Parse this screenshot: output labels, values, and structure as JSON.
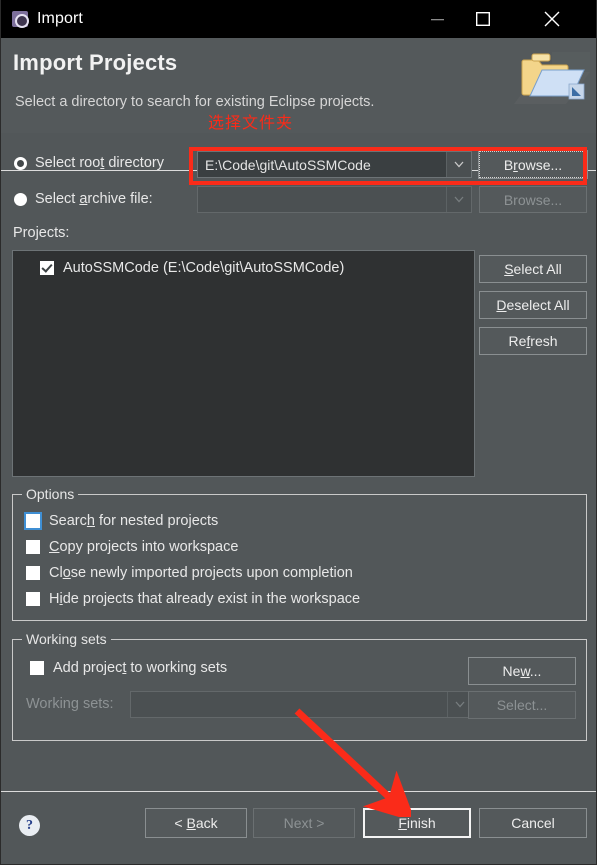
{
  "window": {
    "title": "Import",
    "icon": "eclipse-import-icon",
    "controls": {
      "minimize": "minimize-icon",
      "maximize": "maximize-icon",
      "close": "close-icon"
    }
  },
  "header": {
    "title": "Import Projects",
    "description": "Select a directory to search for existing Eclipse projects.",
    "annotation": "选择文件夹",
    "icon": "open-folder-icon",
    "annotation_color": "#fa2b19"
  },
  "source": {
    "root_directory": {
      "label": "Select roo",
      "label_accel": "t",
      "label_tail": " directory",
      "selected": true,
      "value": "E:\\Code\\git\\AutoSSMCode",
      "browse_label_head": "B",
      "browse_label_accel": "r",
      "browse_label_tail": "owse..."
    },
    "archive_file": {
      "label": "Select ",
      "label_accel": "a",
      "label_tail": "rchive file:",
      "selected": false,
      "value": "",
      "browse_label_head": "B",
      "browse_label_accel": "r",
      "browse_label_tail": "owse..."
    }
  },
  "projects": {
    "label": "Projects:",
    "items": [
      {
        "label": "AutoSSMCode (E:\\Code\\git\\AutoSSMCode)",
        "checked": true
      }
    ],
    "buttons": [
      {
        "head": "",
        "accel": "S",
        "tail": "elect All",
        "enabled": true
      },
      {
        "head": "",
        "accel": "D",
        "tail": "eselect All",
        "enabled": true
      },
      {
        "head": "Re",
        "accel": "f",
        "tail": "resh",
        "enabled": true
      }
    ]
  },
  "options": {
    "title": "Options",
    "items": [
      {
        "head": "Searc",
        "accel": "h",
        "tail": " for nested projects",
        "checked": false,
        "focused": true
      },
      {
        "head": "",
        "accel": "C",
        "tail": "opy projects into workspace",
        "checked": false,
        "focused": false
      },
      {
        "head": "Cl",
        "accel": "o",
        "tail": "se newly imported projects upon completion",
        "checked": false,
        "focused": false
      },
      {
        "head": "H",
        "accel": "i",
        "tail": "de projects that already exist in the workspace",
        "checked": false,
        "focused": false
      }
    ]
  },
  "working_sets": {
    "title": "Working sets",
    "add_checkbox": {
      "head": "Add projec",
      "accel": "t",
      "tail": " to working sets",
      "checked": false
    },
    "new_button": {
      "head": "Ne",
      "accel": "w",
      "tail": "...",
      "enabled": true
    },
    "combo_label": "Working sets:",
    "combo_value": "",
    "select_button": {
      "head": "Select...",
      "accel": "",
      "tail": "",
      "enabled": false
    }
  },
  "footer": {
    "help": "?",
    "buttons": [
      {
        "head": "< ",
        "accel": "B",
        "tail": "ack",
        "enabled": true,
        "default": false
      },
      {
        "head": "N",
        "accel": "",
        "tail": "ext >",
        "enabled": false,
        "default": false
      },
      {
        "head": "",
        "accel": "F",
        "tail": "inish",
        "enabled": true,
        "default": true
      },
      {
        "head": "Cancel",
        "accel": "",
        "tail": "",
        "enabled": true,
        "default": false
      }
    ]
  }
}
